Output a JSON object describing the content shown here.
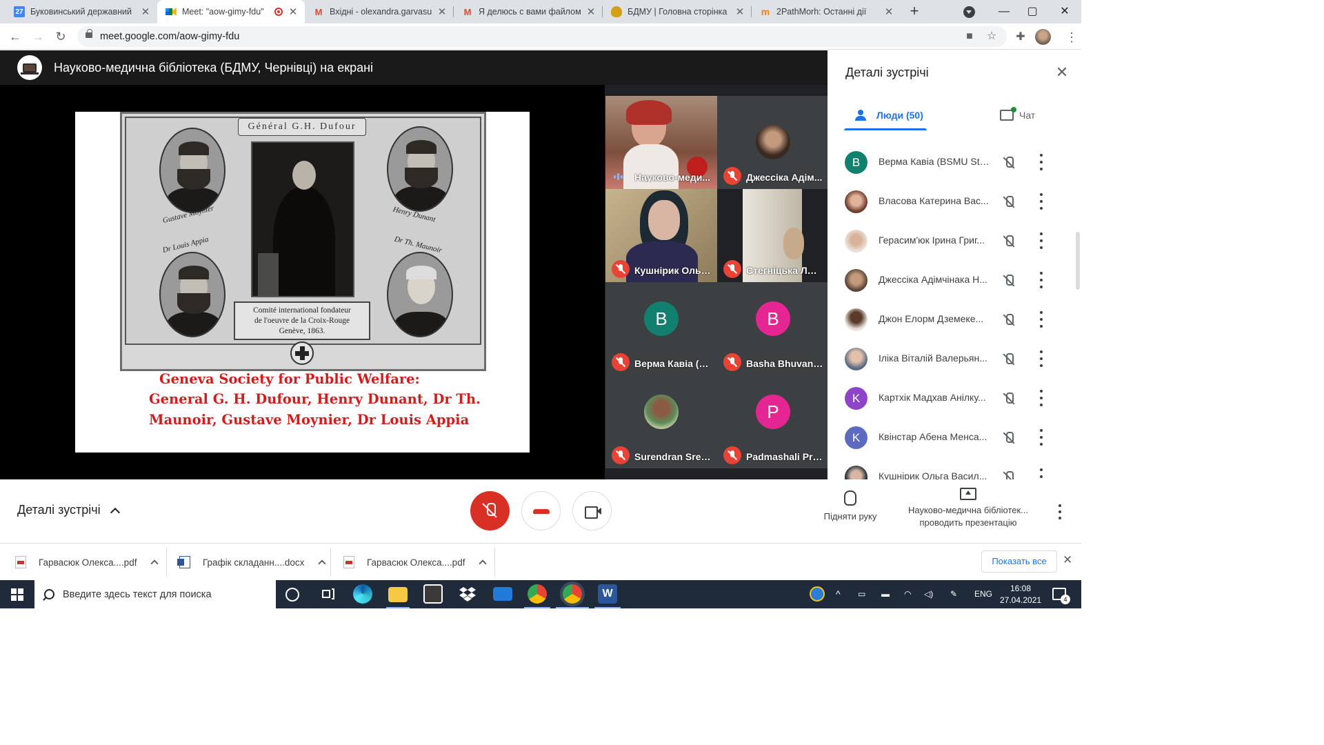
{
  "browser": {
    "tabs": [
      {
        "title": "Буковинський державний",
        "favicon": "calendar-icon",
        "favicon_text": "27",
        "active": false
      },
      {
        "title": "Meet: \"aow-gimy-fdu\"",
        "favicon": "google-meet-icon",
        "active": true,
        "recording": true
      },
      {
        "title": "Вхідні - olexandra.garvasuk",
        "favicon": "gmail-icon",
        "favicon_text": "M",
        "active": false
      },
      {
        "title": "Я делюсь с вами файлом Г",
        "favicon": "gmail-icon",
        "favicon_text": "M",
        "active": false
      },
      {
        "title": "БДМУ | Головна сторінка",
        "favicon": "university-crest-icon",
        "active": false
      },
      {
        "title": "2PathMorh: Останні дії",
        "favicon": "moodle-icon",
        "favicon_text": "m",
        "active": false
      }
    ],
    "url": "meet.google.com/aow-gimy-fdu",
    "window_controls": {
      "minimize": "—",
      "maximize": "▢",
      "close": "✕"
    }
  },
  "meet": {
    "presenter_title": "Науково-медична бібліотека (БДМУ, Чернівці) на екрані",
    "slide": {
      "banner": "Général G.H. Dufour",
      "oval_labels": [
        "Gustave Moynier",
        "Henry Dunant",
        "Dr Louis Appia",
        "Dr Th. Maunoir"
      ],
      "caption": [
        "Comité international fondateur",
        "de l'oeuvre de la Croix-Rouge",
        "Genève, 1863."
      ],
      "title": "Geneva Society for Public Welfare:",
      "line1": "General G. H. Dufour, Henry Dunant, Dr Th.",
      "line2": "Maunoir, Gustave Moynier, Dr Louis Appia"
    },
    "tiles": [
      {
        "name": "Науково-меди...",
        "state": "speaking"
      },
      {
        "name": "Джессіка Адім...",
        "state": "muted"
      },
      {
        "name": "Кушнірик Ольг...",
        "state": "muted"
      },
      {
        "name": "Стегніцька Лю...",
        "state": "muted"
      },
      {
        "name": "Верма Кавіа (В...",
        "state": "muted",
        "letter": "B",
        "color": "#12806e"
      },
      {
        "name": "Basha Bhuvane...",
        "state": "muted",
        "letter": "B",
        "color": "#e52592"
      },
      {
        "name": "Surendran Sreel...",
        "state": "muted"
      },
      {
        "name": "Padmashali Pri...",
        "state": "muted",
        "letter": "P",
        "color": "#e52592"
      }
    ]
  },
  "panel": {
    "title": "Деталі зустрічі",
    "tab_people": "Люди (50)",
    "tab_chat": "Чат",
    "people": [
      {
        "name": "Верма Кавіа (BSMU Stu...",
        "letter": "B",
        "color": "#12806e"
      },
      {
        "name": "Власова Катерина Вас...",
        "photo": true
      },
      {
        "name": "Герасим'юк Ірина Григ...",
        "photo": true
      },
      {
        "name": "Джессіка Адімчінака Н...",
        "photo": true
      },
      {
        "name": "Джон Елорм Дземеке...",
        "photo": true
      },
      {
        "name": "Іліка Віталій Валерьян...",
        "photo": true
      },
      {
        "name": "Картхік Мадхав Анілку...",
        "letter": "K",
        "color": "#8e44c8"
      },
      {
        "name": "Квінстар Абена Менса...",
        "letter": "K",
        "color": "#5c6bc0"
      },
      {
        "name": "Кушнірик Ольга Васил...",
        "photo": true
      }
    ]
  },
  "controls": {
    "meeting_details": "Деталі зустрічі",
    "raise_hand": "Підняти руку",
    "presenting_line1": "Науково-медична бібліотек...",
    "presenting_line2": "проводить презентацію"
  },
  "downloads": {
    "items": [
      {
        "name": "Гарвасюк Олекса....pdf",
        "type": "pdf"
      },
      {
        "name": "Графік складанн....docx",
        "type": "doc"
      },
      {
        "name": "Гарвасюк Олекса....pdf",
        "type": "pdf"
      }
    ],
    "show_all": "Показать все"
  },
  "taskbar": {
    "search_placeholder": "Введите здесь текст для поиска",
    "language": "ENG",
    "time": "16:08",
    "date": "27.04.2021",
    "notification_count": "4"
  }
}
